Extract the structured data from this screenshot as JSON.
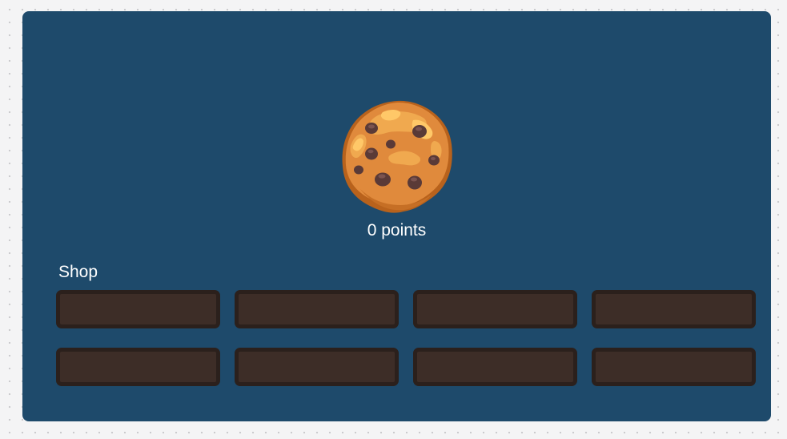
{
  "score": {
    "value": "0 points"
  },
  "cookie": {
    "icon": "cookie-icon"
  },
  "shop": {
    "title": "Shop",
    "items": [
      {
        "label": ""
      },
      {
        "label": ""
      },
      {
        "label": ""
      },
      {
        "label": ""
      },
      {
        "label": ""
      },
      {
        "label": ""
      },
      {
        "label": ""
      },
      {
        "label": ""
      }
    ]
  },
  "colors": {
    "page_background": "#f4f4f5",
    "panel_background": "#1e4a6b",
    "shop_item_fill": "#3d2d27",
    "shop_item_border": "#2b201c",
    "text": "#ffffff"
  }
}
